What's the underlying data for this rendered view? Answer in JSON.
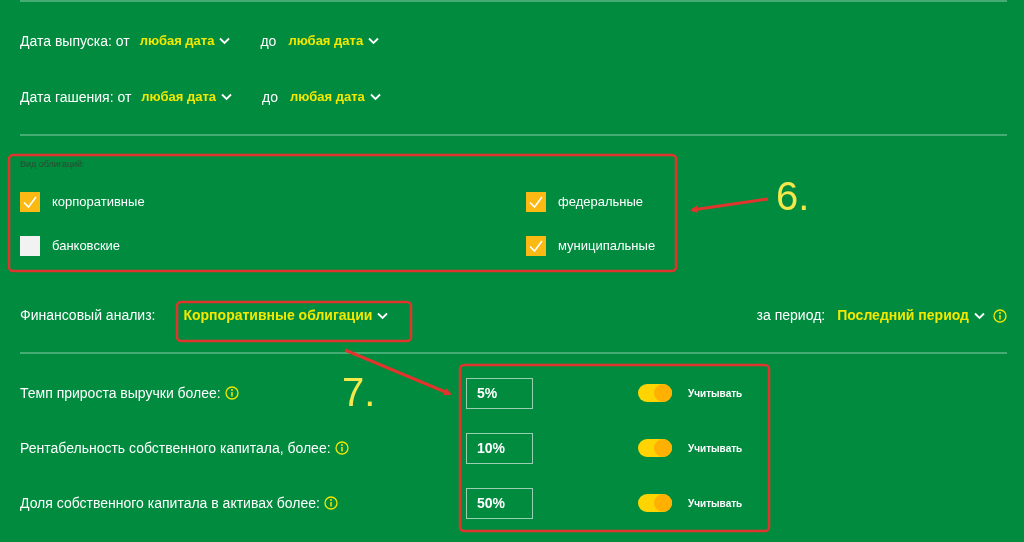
{
  "date_filters": [
    {
      "label": "Дата выпуска: от",
      "from": "любая дата",
      "to_label": "до",
      "to": "любая дата"
    },
    {
      "label": "Дата гашения: от",
      "from": "любая дата",
      "to_label": "до",
      "to": "любая дата"
    }
  ],
  "bond_types": {
    "label": "Вид облигаций:",
    "items": [
      {
        "label": "корпоративные",
        "checked": true
      },
      {
        "label": "федеральные",
        "checked": true
      },
      {
        "label": "банковские",
        "checked": false
      },
      {
        "label": "муниципальные",
        "checked": true
      }
    ]
  },
  "financial_analysis": {
    "label": "Финансовый анализ:",
    "value": "Корпоративные облигации",
    "period_label": "за период:",
    "period_value": "Последний период"
  },
  "criteria": [
    {
      "label": "Темп прироста выручки более:",
      "value": "5%",
      "on": true,
      "toggle_label": "Учитывать"
    },
    {
      "label": "Рентабельность собственного капитала, более:",
      "value": "10%",
      "on": true,
      "toggle_label": "Учитывать"
    },
    {
      "label": "Доля собственного капитала в активах более:",
      "value": "50%",
      "on": true,
      "toggle_label": "Учитывать"
    }
  ],
  "annotations": [
    {
      "label": "6."
    },
    {
      "label": "7."
    }
  ]
}
